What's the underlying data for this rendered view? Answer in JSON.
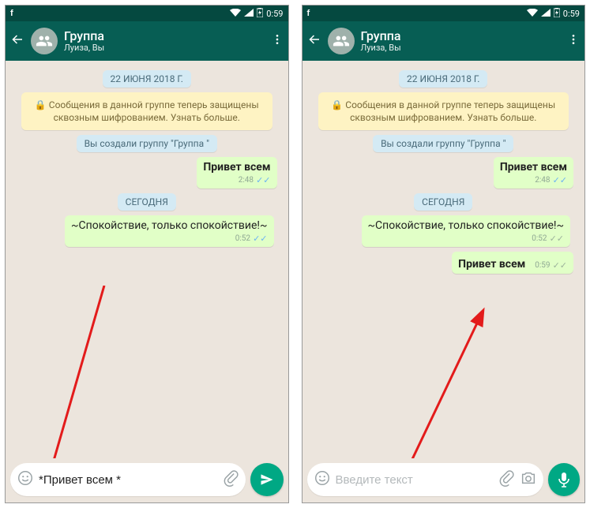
{
  "status": {
    "time": "0:59",
    "fb": "f"
  },
  "header": {
    "title": "Группа",
    "subtitle": "Луиза, Вы"
  },
  "chat": {
    "date1": "22 ИЮНЯ 2018 Г.",
    "encryption": "Сообщения в данной группе теперь защищены сквозным шифрованием. Узнать больше.",
    "created": "Вы создали группу \"Группа \"",
    "date2": "СЕГОДНЯ",
    "m1": {
      "text": "Привет всем",
      "time": "2:48"
    },
    "m2": {
      "text": "~Спокойствие, только спокойствие!~",
      "time": "0:52"
    },
    "m3": {
      "text": "Привет всем",
      "time": "0:59"
    }
  },
  "input": {
    "value_left": "*Привет всем *",
    "placeholder": "Введите текст"
  }
}
